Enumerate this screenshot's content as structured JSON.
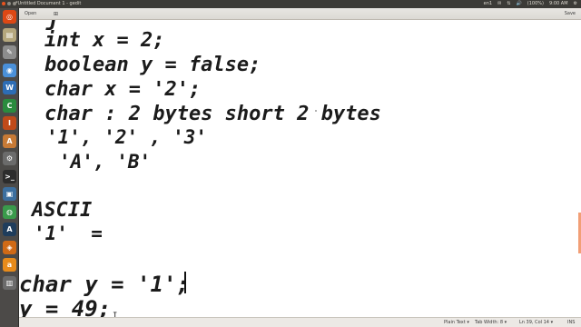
{
  "window": {
    "title": "*Untitled Document 1 - gedit"
  },
  "panel": {
    "indicators": [
      "en1",
      "✉",
      "⇅",
      "🔊",
      "(100%)",
      "9:00 AM",
      "⚙"
    ]
  },
  "header": {
    "open_label": "Open",
    "save_label": "Save"
  },
  "launcher": {
    "items": [
      {
        "icon": "ubuntu-dash-icon",
        "glyph": "◎",
        "color": "#dd4814"
      },
      {
        "icon": "files-icon",
        "glyph": "▤",
        "color": "#b5a77d"
      },
      {
        "icon": "text-editor-icon",
        "glyph": "✎",
        "color": "#8d8d8d"
      },
      {
        "icon": "chromium-icon",
        "glyph": "◉",
        "color": "#4a90d9"
      },
      {
        "icon": "writer-icon",
        "glyph": "W",
        "color": "#2d6db5"
      },
      {
        "icon": "calc-icon",
        "glyph": "C",
        "color": "#2a8b3e"
      },
      {
        "icon": "impress-icon",
        "glyph": "I",
        "color": "#c04a1a"
      },
      {
        "icon": "software-center-icon",
        "glyph": "A",
        "color": "#c77a36"
      },
      {
        "icon": "settings-icon",
        "glyph": "⚙",
        "color": "#6b6b6b"
      },
      {
        "icon": "terminal-icon",
        "glyph": ">_",
        "color": "#2c2c2c"
      },
      {
        "icon": "editor-icon",
        "glyph": "▣",
        "color": "#3c6f9f"
      },
      {
        "icon": "chrome-icon",
        "glyph": "◍",
        "color": "#3a9a4b"
      },
      {
        "icon": "android-studio-icon",
        "glyph": "A",
        "color": "#1f3d5c"
      },
      {
        "icon": "mysql-icon",
        "glyph": "◈",
        "color": "#d06a16"
      },
      {
        "icon": "amazon-icon",
        "glyph": "a",
        "color": "#e78b1b"
      },
      {
        "icon": "trash-icon",
        "glyph": "▥",
        "color": "#6b6b6b"
      }
    ]
  },
  "editor": {
    "lines": [
      "j",
      "int x = 2;",
      "boolean y = false;",
      "char x = '2';",
      "char : 2 bytes short 2 bytes",
      "'1', '2' , '3'",
      "'A', 'B'",
      "ASCII",
      "'1'  =",
      "char y = '1';",
      "y = 49;"
    ],
    "ibeam": "I"
  },
  "status": {
    "plain_text": "Plain Text ▾",
    "tab_width": "Tab Width: 8 ▾",
    "position": "Ln 39, Col 14 ▾",
    "mode": "INS"
  }
}
